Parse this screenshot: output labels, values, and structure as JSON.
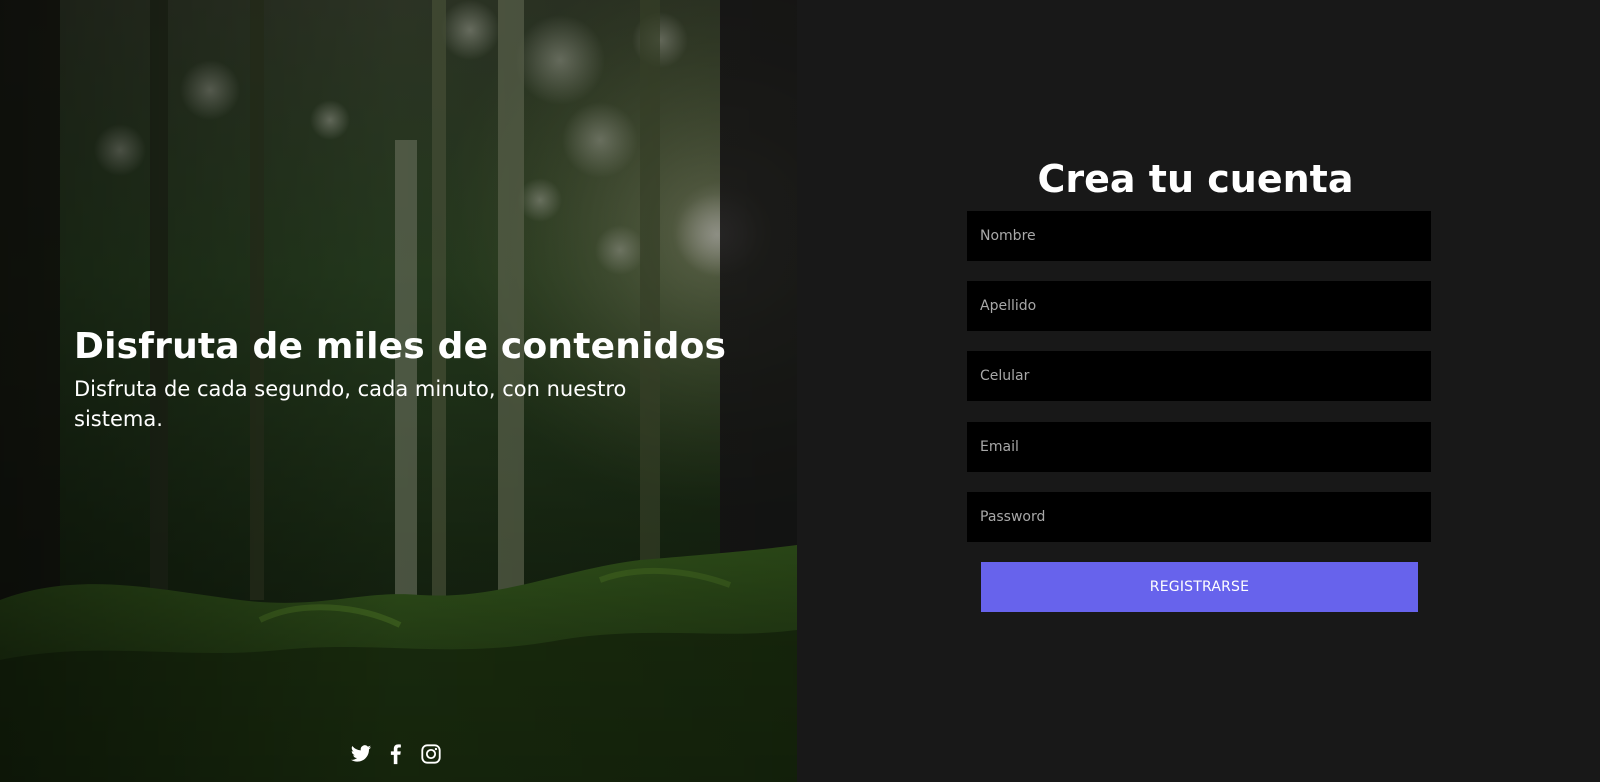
{
  "hero": {
    "title": "Disfruta de miles de contenidos",
    "subtitle": "Disfruta de cada segundo, cada minuto, con nuestro sistema.",
    "social": [
      {
        "icon": "twitter-icon"
      },
      {
        "icon": "facebook-icon"
      },
      {
        "icon": "instagram-icon"
      }
    ]
  },
  "signup": {
    "title": "Crea tu cuenta",
    "fields": {
      "nombre": {
        "placeholder": "Nombre",
        "value": ""
      },
      "apellido": {
        "placeholder": "Apellido",
        "value": ""
      },
      "celular": {
        "placeholder": "Celular",
        "value": ""
      },
      "email": {
        "placeholder": "Email",
        "value": ""
      },
      "password": {
        "placeholder": "Password",
        "value": ""
      }
    },
    "submit_label": "REGISTRARSE"
  },
  "colors": {
    "page_background": "#181818",
    "input_background": "#000000",
    "accent": "#6763ec",
    "text": "#ffffff"
  }
}
